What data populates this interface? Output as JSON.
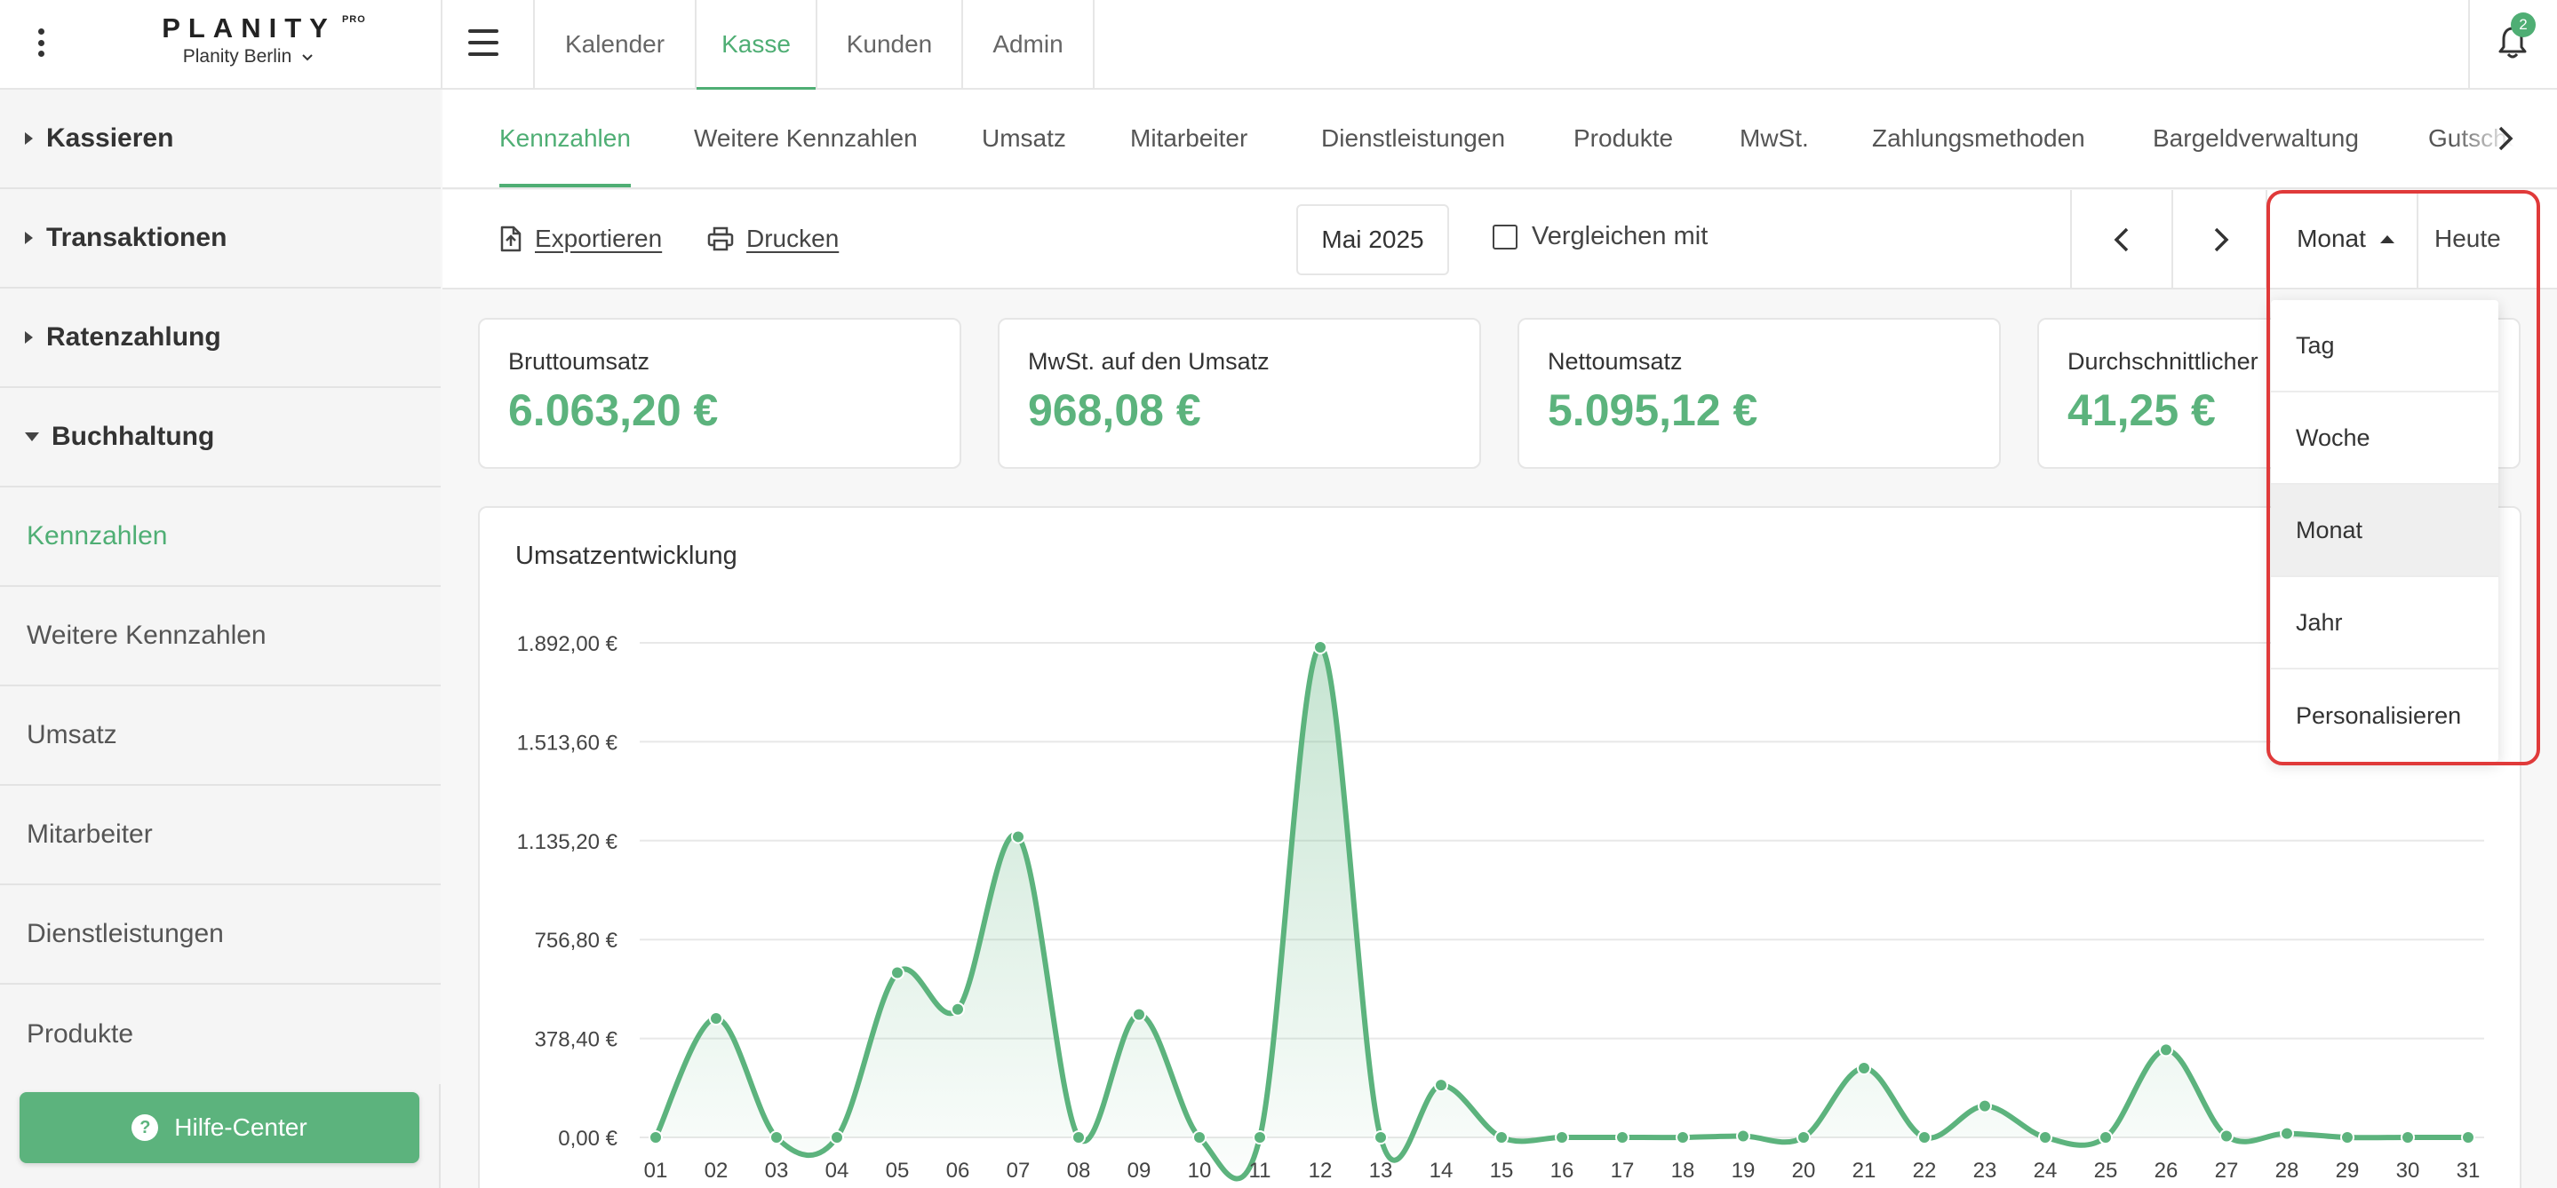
{
  "topbar": {
    "brand": "PLANITY",
    "brand_badge": "PRO",
    "location": "Planity Berlin",
    "tabs": [
      "Kalender",
      "Kasse",
      "Kunden",
      "Admin"
    ],
    "active_tab": "Kasse",
    "notification_count": "2"
  },
  "sidebar": {
    "sections": [
      "Kassieren",
      "Transaktionen",
      "Ratenzahlung",
      "Buchhaltung"
    ],
    "items": [
      "Kennzahlen",
      "Weitere Kennzahlen",
      "Umsatz",
      "Mitarbeiter",
      "Dienstleistungen",
      "Produkte"
    ],
    "active_item": "Kennzahlen",
    "help_label": "Hilfe-Center"
  },
  "subtabs": [
    "Kennzahlen",
    "Weitere Kennzahlen",
    "Umsatz",
    "Mitarbeiter",
    "Dienstleistungen",
    "Produkte",
    "MwSt.",
    "Zahlungsmethoden",
    "Bargeldverwaltung",
    "Gutscheine"
  ],
  "toolbar": {
    "export_label": "Exportieren",
    "print_label": "Drucken",
    "date_label": "Mai 2025",
    "compare_label": "Vergleichen mit",
    "compare_checked": false,
    "period_label": "Monat",
    "today_label": "Heute"
  },
  "kpis": [
    {
      "label": "Bruttoumsatz",
      "value": "6.063,20 €"
    },
    {
      "label": "MwSt. auf den Umsatz",
      "value": "968,08 €"
    },
    {
      "label": "Nettoumsatz",
      "value": "5.095,12 €"
    },
    {
      "label": "Durchschnittlicher",
      "value": "41,25 €"
    }
  ],
  "period_dropdown": {
    "options": [
      "Tag",
      "Woche",
      "Monat",
      "Jahr",
      "Personalisieren"
    ],
    "selected": "Monat"
  },
  "colors": {
    "accent": "#4fae74",
    "highlight_border": "#e03a3a"
  },
  "chart_data": {
    "type": "area",
    "title": "Umsatzentwicklung",
    "categories": [
      "01",
      "02",
      "03",
      "04",
      "05",
      "06",
      "07",
      "08",
      "09",
      "10",
      "11",
      "12",
      "13",
      "14",
      "15",
      "16",
      "17",
      "18",
      "19",
      "20",
      "21",
      "22",
      "23",
      "24",
      "25",
      "26",
      "27",
      "28",
      "29",
      "30",
      "31"
    ],
    "values": [
      0,
      455,
      0,
      0,
      630,
      490,
      1150,
      0,
      470,
      0,
      0,
      1875,
      0,
      200,
      0,
      0,
      0,
      0,
      5,
      0,
      265,
      0,
      120,
      0,
      0,
      335,
      5,
      15,
      0,
      0,
      0
    ],
    "y_tick_labels": [
      "0,00 €",
      "378,40 €",
      "756,80 €",
      "1.135,20 €",
      "1.513,60 €",
      "1.892,00 €"
    ],
    "ylim": [
      0,
      1892
    ],
    "grid": true,
    "color": "#5cb37d"
  }
}
